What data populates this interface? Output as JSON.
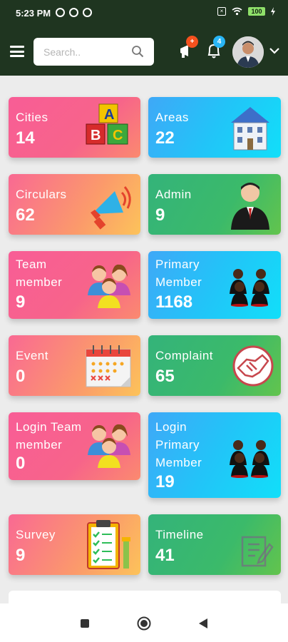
{
  "status": {
    "time": "5:23 PM",
    "battery": "100"
  },
  "header": {
    "search_placeholder": "Search..",
    "notification_badge": "+",
    "alerts_badge": "4",
    "colors": {
      "bar": "#1f3520",
      "badge_orange": "#f4511e",
      "badge_blue": "#29b6f6"
    }
  },
  "cards": [
    {
      "label": "Cities",
      "value": "14",
      "icon": "abc-blocks-icon"
    },
    {
      "label": "Areas",
      "value": "22",
      "icon": "building-icon"
    },
    {
      "label": "Circulars",
      "value": "62",
      "icon": "megaphone-icon"
    },
    {
      "label": "Admin",
      "value": "9",
      "icon": "businessman-icon"
    },
    {
      "label": "Team\nmember",
      "value": "9",
      "icon": "team-people-icon"
    },
    {
      "label": "Primary\nMember",
      "value": "1168",
      "icon": "meeting-people-icon"
    },
    {
      "label": "Event",
      "value": "0",
      "icon": "calendar-icon"
    },
    {
      "label": "Complaint",
      "value": "65",
      "icon": "handshake-icon"
    },
    {
      "label": "Login Team\nmember",
      "value": "0",
      "icon": "team-people-icon"
    },
    {
      "label": "Login\nPrimary\nMember",
      "value": "19",
      "icon": "meeting-people-icon"
    },
    {
      "label": "Survey",
      "value": "9",
      "icon": "clipboard-icon"
    },
    {
      "label": "Timeline",
      "value": "41",
      "icon": "timeline-edit-icon"
    }
  ]
}
